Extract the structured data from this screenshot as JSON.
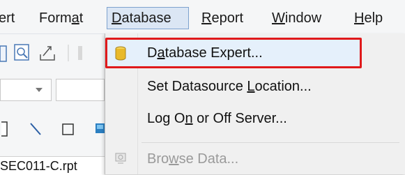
{
  "menubar": {
    "items": [
      {
        "pre": "",
        "ul": "",
        "post": "ert"
      },
      {
        "pre": "Form",
        "ul": "a",
        "post": "t"
      },
      {
        "pre": "",
        "ul": "D",
        "post": "atabase"
      },
      {
        "pre": "",
        "ul": "R",
        "post": "eport"
      },
      {
        "pre": "",
        "ul": "W",
        "post": "indow"
      },
      {
        "pre": "",
        "ul": "H",
        "post": "elp"
      }
    ]
  },
  "dropdown": {
    "items": [
      {
        "pre": "D",
        "ul": "a",
        "post": "tabase Expert..."
      },
      {
        "pre": "Set Datasource ",
        "ul": "L",
        "post": "ocation..."
      },
      {
        "pre": "Log O",
        "ul": "n",
        "post": " or Off Server..."
      },
      {
        "pre": "Bro",
        "ul": "w",
        "post": "se Data..."
      }
    ]
  },
  "tab": {
    "label": "SEC011-C.rpt"
  },
  "colors": {
    "highlight_border": "#e0191b",
    "menu_active_bg": "#dbe6f4"
  },
  "icons": [
    "database-icon",
    "browse-data-icon",
    "print-preview-icon",
    "export-icon",
    "line-tool-icon",
    "box-tool-icon"
  ]
}
